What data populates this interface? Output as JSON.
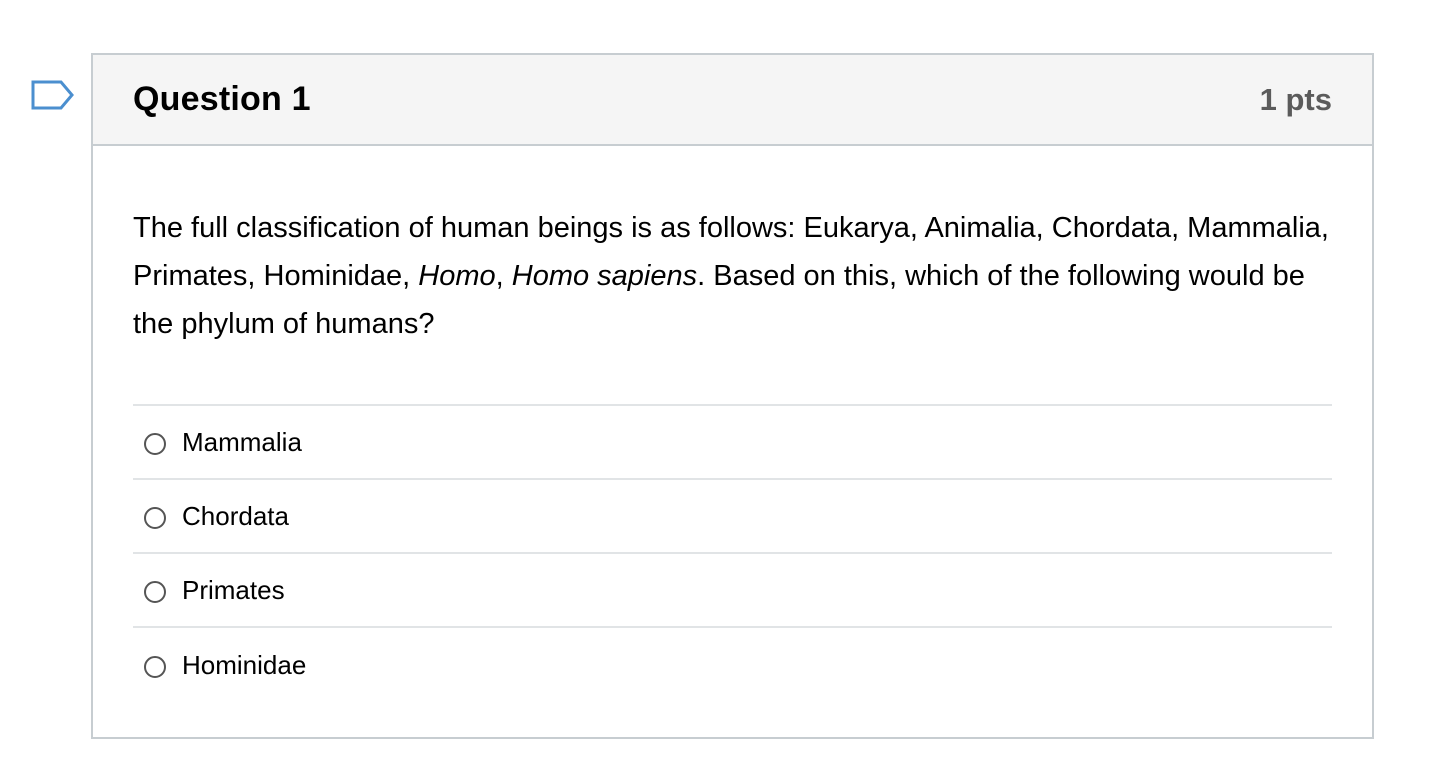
{
  "question": {
    "title": "Question 1",
    "points": "1 pts",
    "text_parts": {
      "a": "The full classification of human beings is as follows: Eukarya, Animalia, Chordata, Mammalia, Primates, Hominidae, ",
      "b": "Homo",
      "c": ", ",
      "d": "Homo sapiens",
      "e": ". Based on this, which of the following would be the phylum of humans?"
    },
    "answers": [
      {
        "label": "Mammalia"
      },
      {
        "label": "Chordata"
      },
      {
        "label": "Primates"
      },
      {
        "label": "Hominidae"
      }
    ]
  },
  "colors": {
    "border": "#c7cdd1",
    "header_bg": "#f5f5f5",
    "flag": "#4b8fcf",
    "points": "#5b5b5b"
  },
  "icons": {
    "flag": "flag-question-icon",
    "radio": "radio-unchecked-icon"
  }
}
